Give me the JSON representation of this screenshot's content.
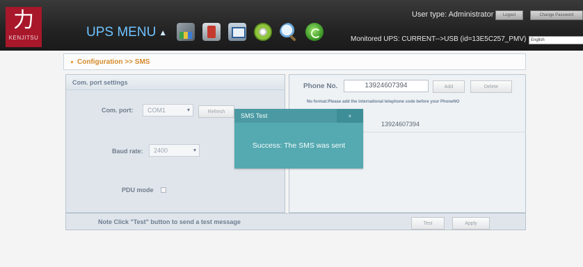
{
  "header": {
    "logo_mark": "力",
    "logo_text": "KENJITSU",
    "menu_title": "UPS MENU",
    "menu_caret": "▲",
    "toolbar_icons": [
      "report-icon",
      "ups-icon",
      "configuration-icon",
      "disk-icon",
      "search-icon",
      "refresh-icon"
    ],
    "user_type": "User type: Administrator",
    "logout_label": "Logout",
    "change_password_label": "Change Password",
    "monitored_ups": "Monitored UPS: CURRENT-->USB (id=13E5C257_PMV)",
    "language": "English"
  },
  "breadcrumb": "Configuration >> SMS",
  "com_settings": {
    "title": "Com. port settings",
    "com_port_label": "Com. port:",
    "com_port_value": "COM1",
    "refresh_label": "Refresh",
    "baud_rate_label": "Baud rate:",
    "baud_rate_value": "2400",
    "pdu_mode_label": "PDU mode"
  },
  "phone": {
    "label": "Phone No.",
    "input_value": "13924607394",
    "add_label": "Add",
    "delete_label": "Delete",
    "format_note": "No format:Please add the international telephone code before your PhoneNO",
    "numbers": [
      "13924607394"
    ]
  },
  "footer": {
    "note": "Note   Click  \"Test\"  button to send a test message",
    "test_label": "Test",
    "apply_label": "Apply"
  },
  "dialog": {
    "title": "SMS Test",
    "close": "×",
    "message": "Success: The SMS was sent"
  },
  "colors": {
    "header_bg": "#232323",
    "brand_red": "#a8172a",
    "breadcrumb_orange": "#d68a2b",
    "dialog_teal": "#55a9b1"
  }
}
